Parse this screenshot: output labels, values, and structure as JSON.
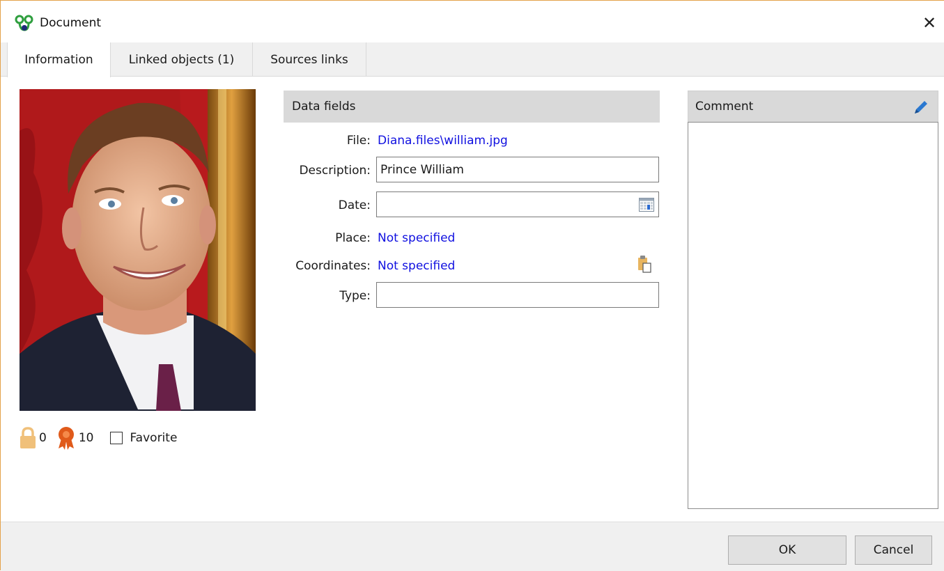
{
  "window": {
    "title": "Document",
    "close_glyph": "✕",
    "icon": "app-logo-icon"
  },
  "tabs": [
    {
      "label": "Information",
      "active": true
    },
    {
      "label": "Linked objects (1)",
      "active": false
    },
    {
      "label": "Sources links",
      "active": false
    }
  ],
  "photo": {
    "icon": "portrait-photo"
  },
  "stats": {
    "lock_count": "0",
    "award_count": "10",
    "favorite_label": "Favorite",
    "favorite_checked": false
  },
  "data_fields": {
    "header": "Data fields",
    "file_label": "File:",
    "file_value": "Diana.files\\william.jpg",
    "description_label": "Description:",
    "description_value": "Prince William",
    "date_label": "Date:",
    "date_value": "",
    "place_label": "Place:",
    "place_value": "Not specified",
    "coordinates_label": "Coordinates:",
    "coordinates_value": "Not specified",
    "type_label": "Type:",
    "type_value": ""
  },
  "comment": {
    "header": "Comment",
    "text": ""
  },
  "buttons": {
    "ok": "OK",
    "cancel": "Cancel"
  },
  "colors": {
    "link": "#1010e0",
    "accent_border": "#e4a24a",
    "header_bg": "#d9d9d9"
  }
}
